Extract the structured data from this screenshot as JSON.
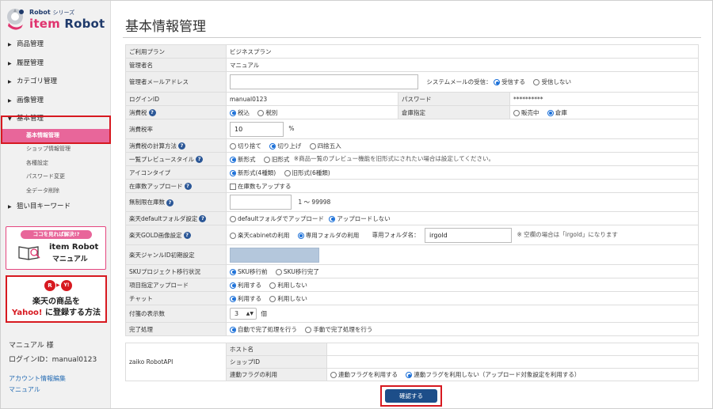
{
  "brand": {
    "small": "Robot",
    "small_suffix": "シリーズ",
    "big_prefix": "item ",
    "big_main": "Robot"
  },
  "nav": {
    "items": [
      {
        "label": "商品管理"
      },
      {
        "label": "履歴管理"
      },
      {
        "label": "カテゴリ管理"
      },
      {
        "label": "画像管理"
      },
      {
        "label": "基本管理"
      }
    ],
    "sub_items": [
      {
        "label": "基本情報管理"
      },
      {
        "label": "ショップ情報管理"
      },
      {
        "label": "各種設定"
      },
      {
        "label": "パスワード変更"
      },
      {
        "label": "全データ削除"
      }
    ],
    "last_item": {
      "label": "狙い目キーワード"
    }
  },
  "banner1": {
    "pill": "ココを見れば解決!?",
    "line1": "item Robot",
    "line2": "マニュアル"
  },
  "banner2": {
    "r": "R",
    "y": "Y!",
    "line1": "楽天の商品を",
    "line2_yahoo": "Yahoo!",
    "line2_rest": " に登録する方法"
  },
  "user": {
    "name": "マニュアル 様",
    "login": "ログインID：manual0123"
  },
  "links": {
    "account": "アカウント情報編集",
    "manual": "マニュアル"
  },
  "page": {
    "title": "基本情報管理"
  },
  "form": {
    "plan_label": "ご利用プラン",
    "plan_value": "ビジネスプラン",
    "admin_label": "管理者名",
    "admin_value": "マニュアル",
    "email_label": "管理者メールアドレス",
    "email_value": "",
    "sysmail_label": "システムメールの受信：",
    "sysmail_opt1": "受信する",
    "sysmail_opt2": "受信しない",
    "login_label": "ログインID",
    "login_value": "manual0123",
    "password_label": "パスワード",
    "password_value": "**********",
    "tax_label": "消費税",
    "tax_opt1": "税込",
    "tax_opt2": "税別",
    "warehouse_label": "倉庫指定",
    "warehouse_opt1": "販売中",
    "warehouse_opt2": "倉庫",
    "taxrate_label": "消費税率",
    "taxrate_value": "10",
    "taxrate_unit": "%",
    "calc_label": "消費税の計算方法",
    "calc_opt1": "切り捨て",
    "calc_opt2": "切り上げ",
    "calc_opt3": "四捨五入",
    "preview_label": "一覧プレビュースタイル",
    "preview_opt1": "新形式",
    "preview_opt2": "旧形式",
    "preview_note": "※商品一覧のプレビュー機能を旧形式にされたい場合は設定してください。",
    "icon_label": "アイコンタイプ",
    "icon_opt1": "新形式(4種類)",
    "icon_opt2": "旧形式(6種類)",
    "stockup_label": "在庫数アップロード",
    "stockup_opt": "在庫数もアップする",
    "unlimited_label": "無制限在庫数",
    "unlimited_value": "",
    "unlimited_range": "1 〜 99998",
    "rakuten_folder_label": "楽天defaultフォルダ設定",
    "rakuten_folder_opt1": "defaultフォルダでアップロード",
    "rakuten_folder_opt2": "アップロードしない",
    "gold_label": "楽天GOLD画像設定",
    "gold_opt1": "楽天cabinetの利用",
    "gold_opt2": "専用フォルダの利用",
    "gold_folder_label": "専用フォルダ名：",
    "gold_folder_value": "irgold",
    "gold_note": "※ 空欄の場合は「irgold」になります",
    "genre_label": "楽天ジャンルID初期設定",
    "sku_label": "SKUプロジェクト移行状況",
    "sku_opt1": "SKU移行前",
    "sku_opt2": "SKU移行完了",
    "itemup_label": "項目指定アップロード",
    "itemup_opt1": "利用する",
    "itemup_opt2": "利用しない",
    "chat_label": "チャット",
    "chat_opt1": "利用する",
    "chat_opt2": "利用しない",
    "tag_label": "付箋の表示数",
    "tag_value": "3",
    "tag_unit": "個",
    "done_label": "完了処理",
    "done_opt1": "自動で完了処理を行う",
    "done_opt2": "手動で完了処理を行う"
  },
  "api": {
    "label": "zaiko RobotAPI",
    "host_label": "ホスト名",
    "host_value": "",
    "shop_label": "ショップID",
    "shop_value": "",
    "flag_label": "連動フラグの利用",
    "flag_opt1": "連動フラグを利用する",
    "flag_opt2": "連動フラグを利用しない（アップロード対象設定を利用する）"
  },
  "confirm_label": "確認する",
  "colors": {
    "accent": "#e8669a",
    "primary": "#1d4e89",
    "highlight": "#d71920",
    "radio": "#1a6fd8"
  }
}
